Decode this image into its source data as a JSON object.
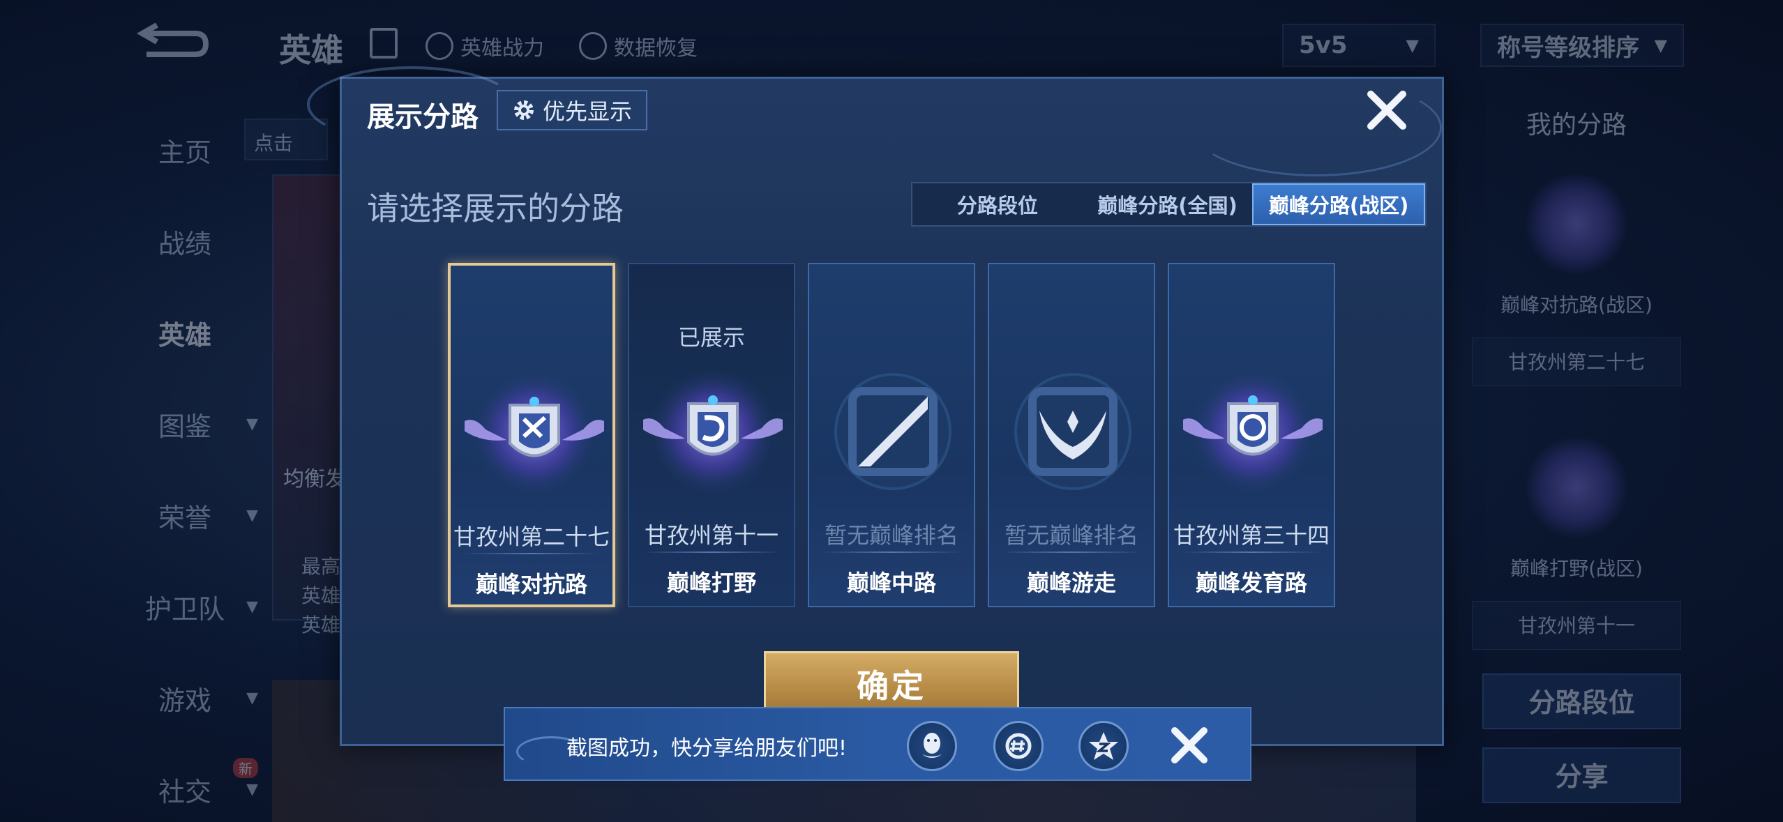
{
  "header": {
    "title": "英雄",
    "links": [
      "英雄战力",
      "数据恢复"
    ],
    "mode_dropdown": "5v5",
    "sort_dropdown": "称号等级排序"
  },
  "side_nav": [
    {
      "label": "主页",
      "active": false,
      "has_chevron": false
    },
    {
      "label": "战绩",
      "active": false,
      "has_chevron": false
    },
    {
      "label": "英雄",
      "active": true,
      "has_chevron": false
    },
    {
      "label": "图鉴",
      "active": false,
      "has_chevron": true
    },
    {
      "label": "荣誉",
      "active": false,
      "has_chevron": true
    },
    {
      "label": "护卫队",
      "active": false,
      "has_chevron": true
    },
    {
      "label": "游戏",
      "active": false,
      "has_chevron": true
    },
    {
      "label": "社交",
      "active": false,
      "has_chevron": true,
      "badge": "新"
    }
  ],
  "background_hero": {
    "hint": "点击",
    "tag": "均衡发",
    "stats": [
      "最高",
      "英雄",
      "英雄"
    ]
  },
  "right_panel": {
    "title": "我的分路",
    "entries": [
      {
        "lane": "巅峰对抗路(战区)",
        "rank": "甘孜州第二十七"
      },
      {
        "lane": "巅峰打野(战区)",
        "rank": "甘孜州第十一"
      }
    ],
    "buttons": [
      "分路段位",
      "分享"
    ]
  },
  "modal": {
    "title": "展示分路",
    "priority_label": "优先显示",
    "section_label": "请选择展示的分路",
    "tabs": [
      {
        "label": "分路段位",
        "active": false
      },
      {
        "label": "巅峰分路(全国)",
        "active": false
      },
      {
        "label": "巅峰分路(战区)",
        "active": true
      }
    ],
    "lanes": [
      {
        "name": "巅峰对抗路",
        "rank": "甘孜州第二十七",
        "shown": "",
        "selected": true,
        "ranked": true,
        "icon": "top-lane-emblem"
      },
      {
        "name": "巅峰打野",
        "rank": "甘孜州第十一",
        "shown": "已展示",
        "selected": false,
        "ranked": true,
        "icon": "jungle-emblem"
      },
      {
        "name": "巅峰中路",
        "rank": "暂无巅峰排名",
        "shown": "",
        "selected": false,
        "ranked": false,
        "icon": "mid-lane-icon"
      },
      {
        "name": "巅峰游走",
        "rank": "暂无巅峰排名",
        "shown": "",
        "selected": false,
        "ranked": false,
        "icon": "roam-icon"
      },
      {
        "name": "巅峰发育路",
        "rank": "甘孜州第三十四",
        "shown": "",
        "selected": false,
        "ranked": true,
        "icon": "bot-lane-emblem"
      }
    ],
    "confirm_label": "确定"
  },
  "toast": {
    "message": "截图成功，快分享给朋友们吧!",
    "share_targets": [
      "qq-icon",
      "wechat-moments-icon",
      "qzone-icon"
    ]
  },
  "colors": {
    "accent_gold": "#e4c994",
    "active_tab": "#3e7cd0",
    "modal_bg": "#1c3257"
  }
}
